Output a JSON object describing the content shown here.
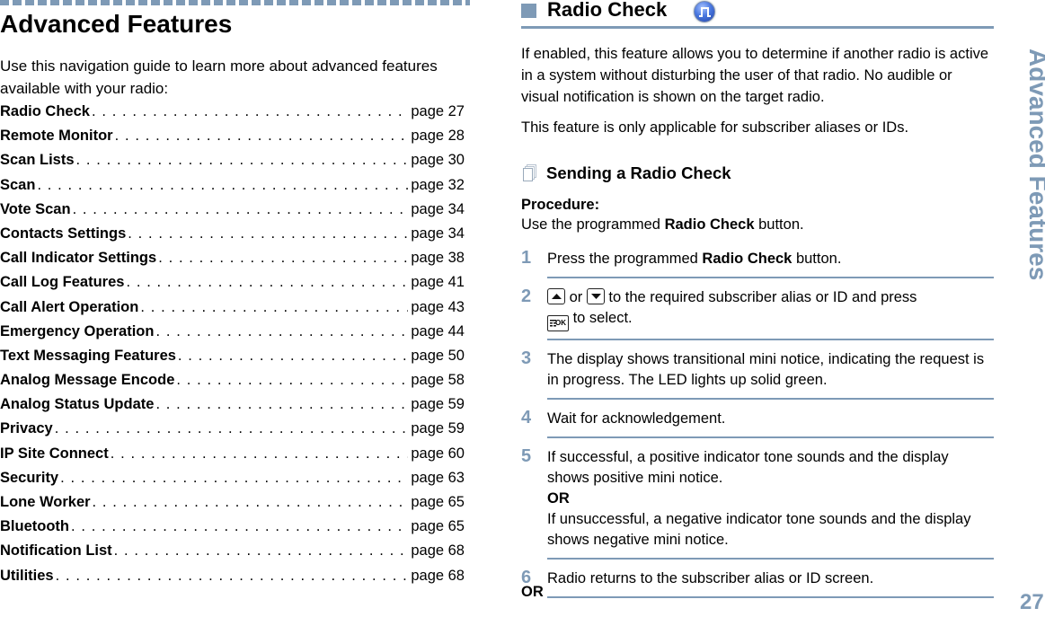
{
  "left": {
    "title": "Advanced Features",
    "intro": "Use this navigation guide to learn more about advanced features available with your radio:",
    "toc": [
      {
        "title": "Radio Check",
        "page": "page 27"
      },
      {
        "title": "Remote Monitor",
        "page": "page 28"
      },
      {
        "title": "Scan Lists",
        "page": "page 30"
      },
      {
        "title": "Scan",
        "page": "page 32"
      },
      {
        "title": "Vote Scan",
        "page": "page 34"
      },
      {
        "title": "Contacts Settings",
        "page": "page 34"
      },
      {
        "title": "Call Indicator Settings",
        "page": "page 38"
      },
      {
        "title": "Call Log Features",
        "page": "page 41"
      },
      {
        "title": "Call Alert Operation",
        "page": "page 43"
      },
      {
        "title": "Emergency Operation",
        "page": "page 44"
      },
      {
        "title": "Text Messaging Features",
        "page": "page 50"
      },
      {
        "title": "Analog Message Encode",
        "page": "page 58"
      },
      {
        "title": "Analog Status Update",
        "page": "page 59"
      },
      {
        "title": "Privacy",
        "page": "page 59"
      },
      {
        "title": "IP Site Connect",
        "page": "page 60"
      },
      {
        "title": "Security",
        "page": "page 63"
      },
      {
        "title": "Lone Worker",
        "page": "page 65"
      },
      {
        "title": "Bluetooth",
        "page": "page 65"
      },
      {
        "title": "Notification List",
        "page": "page 68"
      },
      {
        "title": "Utilities",
        "page": "page 68"
      }
    ]
  },
  "right": {
    "section_title": "Radio Check",
    "section_icon": "radio-check-feature-icon",
    "para1": "If enabled, this feature allows you to determine if another radio is active in a system without disturbing the user of that radio. No audible or visual notification is shown on the target radio.",
    "para2": "This feature is only applicable for subscriber aliases or IDs.",
    "subsection_title": "Sending a Radio Check",
    "subsection_icon": "document-icon",
    "procedure_label": "Procedure:",
    "procedure_text_before": "Use the programmed ",
    "procedure_text_bold": "Radio Check",
    "procedure_text_after": " button.",
    "steps": [
      {
        "num": "1",
        "before": "Press the programmed ",
        "bold": "Radio Check",
        "after": " button."
      },
      {
        "num": "2",
        "or": " or ",
        "text1": " to the required subscriber alias or ID and press ",
        "text2": " to select.",
        "key_up": "up-arrow-key-icon",
        "key_down": "down-arrow-key-icon",
        "key_ok": "OK",
        "key_ok_icon": "menu-ok-key-icon"
      },
      {
        "num": "3",
        "text": "The display shows transitional mini notice, indicating the request is in progress. The LED lights up solid green."
      },
      {
        "num": "4",
        "text": "Wait for acknowledgement."
      },
      {
        "num": "5",
        "text1": "If successful, a positive indicator tone sounds and the display shows positive mini notice.",
        "or": "OR",
        "text2": "If unsuccessful, a negative indicator tone sounds and the display shows negative mini notice."
      },
      {
        "num": "6",
        "text": "Radio returns to the subscriber alias or ID screen."
      }
    ],
    "final_or": "OR"
  },
  "side_tab": "Advanced Features",
  "page_number": "27",
  "colors": {
    "accent": "#7e9ab6",
    "text": "#000000"
  }
}
